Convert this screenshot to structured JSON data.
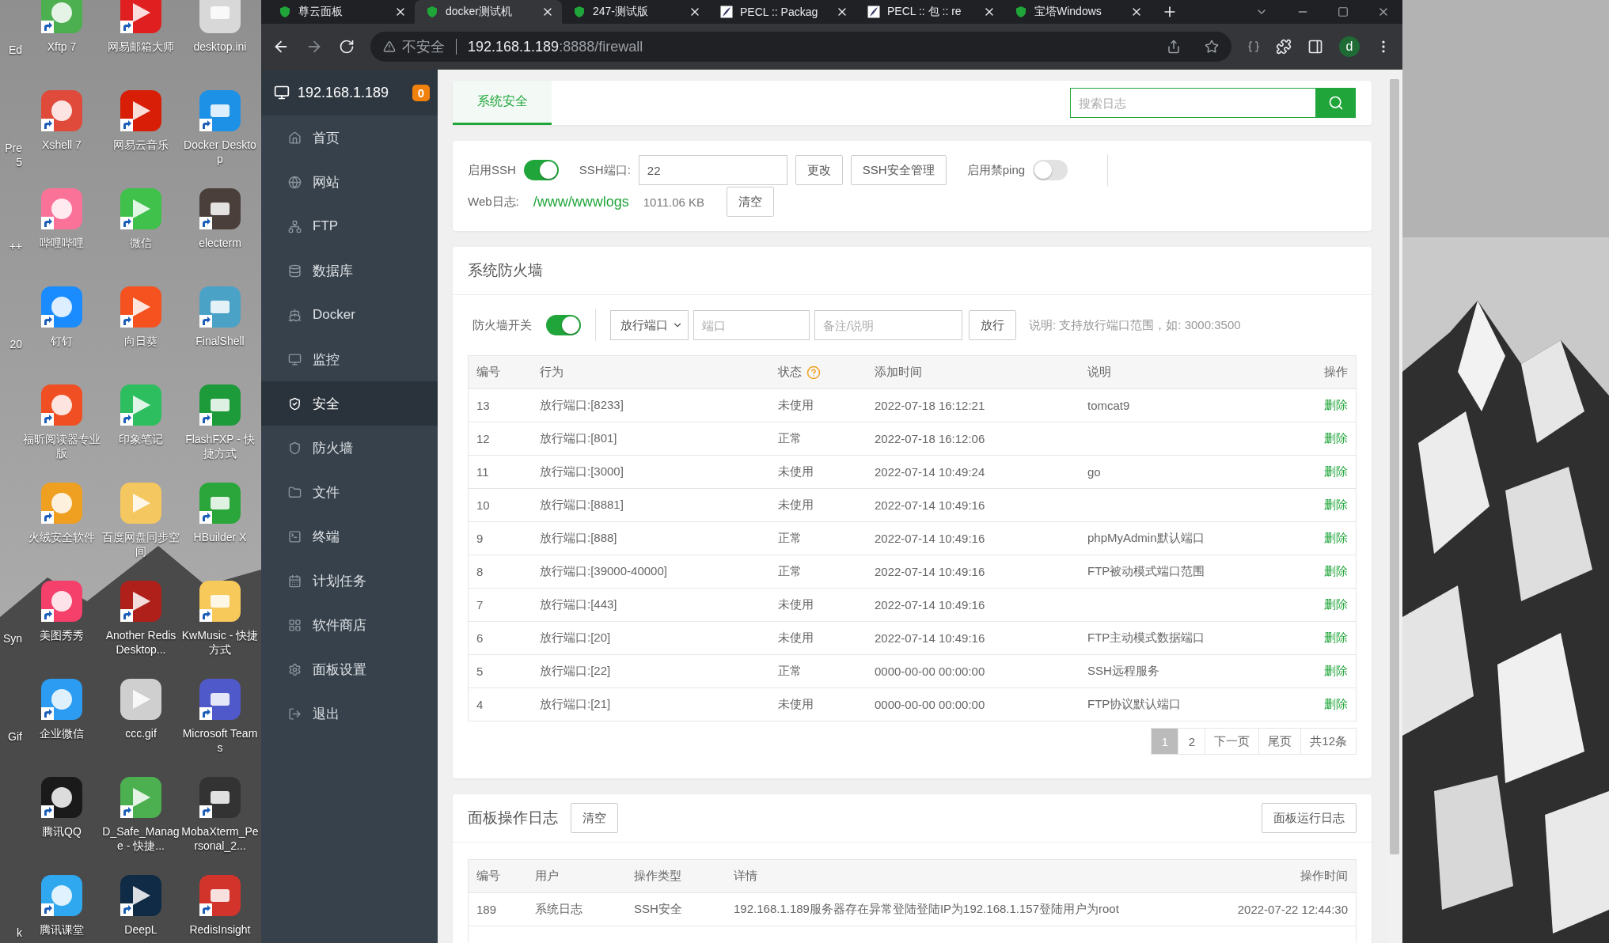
{
  "desktop": {
    "partial_column": [
      {
        "kind": "label",
        "label": "Ed"
      },
      {
        "kind": "label",
        "label": "Pre 5"
      },
      {
        "kind": "label",
        "label": "++"
      },
      {
        "kind": "label",
        "label": "20"
      },
      {
        "kind": "blank"
      },
      {
        "kind": "blank"
      },
      {
        "kind": "label",
        "label": "Syn"
      },
      {
        "kind": "label",
        "label": "Gif"
      },
      {
        "kind": "blank"
      },
      {
        "kind": "label",
        "label": "k"
      }
    ],
    "icons": [
      {
        "label": "Xftp 7",
        "color": "#4caf50",
        "shortcut": true
      },
      {
        "label": "网易邮箱大师",
        "color": "#e02020",
        "shortcut": true
      },
      {
        "label": "desktop.ini",
        "color": "#d8d8d8",
        "shortcut": false
      },
      {
        "label": "Xshell 7",
        "color": "#e04a3a",
        "shortcut": true
      },
      {
        "label": "网易云音乐",
        "color": "#d81e06",
        "shortcut": true
      },
      {
        "label": "Docker Desktop",
        "color": "#1d91e6",
        "shortcut": true
      },
      {
        "label": "哔哩哔哩",
        "color": "#fb7299",
        "shortcut": true
      },
      {
        "label": "微信",
        "color": "#3fc14b",
        "shortcut": true
      },
      {
        "label": "electerm",
        "color": "#4a3f3a",
        "shortcut": true
      },
      {
        "label": "钉钉",
        "color": "#1a8cff",
        "shortcut": true
      },
      {
        "label": "向日葵",
        "color": "#f5521f",
        "shortcut": true
      },
      {
        "label": "FinalShell",
        "color": "#4aa3c7",
        "shortcut": true
      },
      {
        "label": "福昕阅读器专业版",
        "color": "#f04e23",
        "shortcut": true
      },
      {
        "label": "印象笔记",
        "color": "#2dbe60",
        "shortcut": true
      },
      {
        "label": "FlashFXP - 快捷方式",
        "color": "#1d9a3a",
        "shortcut": true
      },
      {
        "label": "火绒安全软件",
        "color": "#f0a020",
        "shortcut": true
      },
      {
        "label": "百度网盘同步空间",
        "color": "#f5c760",
        "shortcut": false
      },
      {
        "label": "HBuilder X",
        "color": "#2aa63a",
        "shortcut": true
      },
      {
        "label": "美图秀秀",
        "color": "#f4406a",
        "shortcut": true
      },
      {
        "label": "Another Redis Desktop...",
        "color": "#b0201a",
        "shortcut": true
      },
      {
        "label": "KwMusic - 快捷方式",
        "color": "#f7c85a",
        "shortcut": true
      },
      {
        "label": "企业微信",
        "color": "#2b9cf2",
        "shortcut": true
      },
      {
        "label": "ccc.gif",
        "color": "#cfcfcf",
        "shortcut": false
      },
      {
        "label": "Microsoft Teams",
        "color": "#5059c9",
        "shortcut": true
      },
      {
        "label": "腾讯QQ",
        "color": "#1a1a1a",
        "shortcut": true
      },
      {
        "label": "D_Safe_Manage - 快捷...",
        "color": "#4cb050",
        "shortcut": true
      },
      {
        "label": "MobaXterm_Personal_2...",
        "color": "#333333",
        "shortcut": true
      },
      {
        "label": "腾讯课堂",
        "color": "#2fa8f0",
        "shortcut": true
      },
      {
        "label": "DeepL",
        "color": "#0f2b46",
        "shortcut": true
      },
      {
        "label": "RedisInsight",
        "color": "#d2342b",
        "shortcut": true
      }
    ]
  },
  "browser": {
    "tabs": [
      {
        "title": "尊云面板",
        "kind": "shield",
        "selected": false
      },
      {
        "title": "docker测试机",
        "kind": "shield",
        "selected": true
      },
      {
        "title": "247-测试版",
        "kind": "shield",
        "selected": false
      },
      {
        "title": "PECL :: Packag",
        "kind": "pecl",
        "selected": false
      },
      {
        "title": "PECL :: 包 :: re",
        "kind": "pecl",
        "selected": false
      },
      {
        "title": "宝塔Windows",
        "kind": "shield",
        "selected": false
      }
    ],
    "address": {
      "security": "不安全",
      "host": "192.168.1.189",
      "path": ":8888/firewall"
    },
    "profile": "d"
  },
  "sidebar": {
    "host": "192.168.1.189",
    "badge": "0",
    "items": [
      {
        "label": "首页",
        "selected": false
      },
      {
        "label": "网站",
        "selected": false
      },
      {
        "label": "FTP",
        "selected": false
      },
      {
        "label": "数据库",
        "selected": false
      },
      {
        "label": "Docker",
        "selected": false
      },
      {
        "label": "监控",
        "selected": false
      },
      {
        "label": "安全",
        "selected": true
      },
      {
        "label": "防火墙",
        "selected": false
      },
      {
        "label": "文件",
        "selected": false
      },
      {
        "label": "终端",
        "selected": false
      },
      {
        "label": "计划任务",
        "selected": false
      },
      {
        "label": "软件商店",
        "selected": false
      },
      {
        "label": "面板设置",
        "selected": false
      },
      {
        "label": "退出",
        "selected": false
      }
    ]
  },
  "top_card": {
    "tabs": [
      {
        "label": "系统安全",
        "selected": true
      }
    ],
    "search": {
      "placeholder": "搜索日志"
    }
  },
  "ssh_card": {
    "ssh_label": "启用SSH",
    "ssh_on": true,
    "port_label": "SSH端口:",
    "port_value": "22",
    "change_button": "更改",
    "manage_button": "SSH安全管理",
    "ping_label": "启用禁ping",
    "ping_on": false,
    "weblog_label": "Web日志:",
    "weblog_path": "/www/wwwlogs",
    "weblog_size": "1011.06 KB",
    "clear_button": "清空"
  },
  "firewall": {
    "title": "系统防火墙",
    "switch_label": "防火墙开关",
    "on": true,
    "select": "放行端口",
    "port_placeholder": "端口",
    "note_placeholder": "备注/说明",
    "allow_button": "放行",
    "hint": "说明: 支持放行端口范围，如: 3000:3500",
    "columns": [
      {
        "label": "编号"
      },
      {
        "label": "行为"
      },
      {
        "label": "状态",
        "help_icon": true
      },
      {
        "label": "添加时间"
      },
      {
        "label": "说明"
      },
      {
        "label": "操作"
      }
    ],
    "rows": [
      {
        "id": "13",
        "action": "放行端口:[8233]",
        "status": "未使用",
        "time": "2022-07-18 16:12:21",
        "note": "tomcat9",
        "op": "删除"
      },
      {
        "id": "12",
        "action": "放行端口:[801]",
        "status": "正常",
        "time": "2022-07-18 16:12:06",
        "op": "删除"
      },
      {
        "id": "11",
        "action": "放行端口:[3000]",
        "status": "未使用",
        "time": "2022-07-14 10:49:24",
        "note": "go",
        "op": "删除"
      },
      {
        "id": "10",
        "action": "放行端口:[8881]",
        "status": "未使用",
        "time": "2022-07-14 10:49:16",
        "op": "删除"
      },
      {
        "id": "9",
        "action": "放行端口:[888]",
        "status": "正常",
        "time": "2022-07-14 10:49:16",
        "note": "phpMyAdmin默认端口",
        "op": "删除"
      },
      {
        "id": "8",
        "action": "放行端口:[39000-40000]",
        "status": "正常",
        "time": "2022-07-14 10:49:16",
        "note": "FTP被动模式端口范围",
        "op": "删除"
      },
      {
        "id": "7",
        "action": "放行端口:[443]",
        "status": "未使用",
        "time": "2022-07-14 10:49:16",
        "op": "删除"
      },
      {
        "id": "6",
        "action": "放行端口:[20]",
        "status": "未使用",
        "time": "2022-07-14 10:49:16",
        "note": "FTP主动模式数据端口",
        "op": "删除"
      },
      {
        "id": "5",
        "action": "放行端口:[22]",
        "status": "正常",
        "time": "0000-00-00 00:00:00",
        "note": "SSH远程服务",
        "op": "删除"
      },
      {
        "id": "4",
        "action": "放行端口:[21]",
        "status": "未使用",
        "time": "0000-00-00 00:00:00",
        "note": "FTP协议默认端口",
        "op": "删除"
      }
    ],
    "pagination": {
      "pages": [
        {
          "label": "1",
          "selected": true
        },
        {
          "label": "2",
          "selected": false
        }
      ],
      "next": "下一页",
      "last": "尾页",
      "total": "共12条"
    }
  },
  "panel_log": {
    "title": "面板操作日志",
    "clear_button": "清空",
    "run_log_button": "面板运行日志",
    "columns": [
      {
        "label": "编号"
      },
      {
        "label": "用户"
      },
      {
        "label": "操作类型"
      },
      {
        "label": "详情"
      },
      {
        "label": "操作时间"
      }
    ],
    "rows": [
      {
        "id": "189",
        "user": "系统日志",
        "type": "SSH安全",
        "detail": "192.168.1.189服务器存在异常登陆登陆IP为192.168.1.157登陆用户为root",
        "time": "2022-07-22 12:44:30"
      }
    ]
  }
}
